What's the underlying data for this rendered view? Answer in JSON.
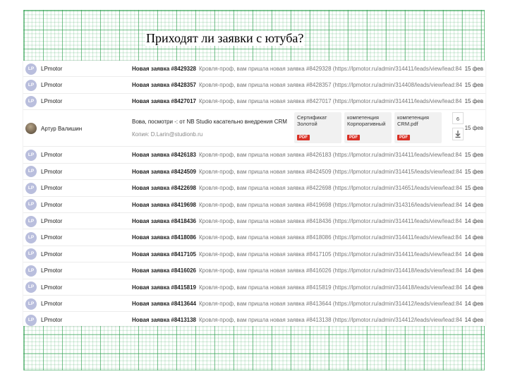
{
  "slide": {
    "title": "Приходят ли заявки с ютуба?"
  },
  "colors": {
    "avatar_bg": "#b9bedd",
    "pdf_badge": "#d93025",
    "grid_line": "#2ea050"
  },
  "inbox": {
    "rows_before": [
      {
        "avatar": "LP",
        "sender": "LPmotor",
        "subject": "Новая заявка #8429328",
        "preview": "Кровля-проф, вам пришла новая заявка #8429328 (https://lpmotor.ru/admin/314411/leads/view/lead:84...",
        "date": "15 фев"
      },
      {
        "avatar": "LP",
        "sender": "LPmotor",
        "subject": "Новая заявка #8428357",
        "preview": "Кровля-проф, вам пришла новая заявка #8428357 (https://lpmotor.ru/admin/314408/leads/view/lead:84...",
        "date": "15 фев"
      },
      {
        "avatar": "LP",
        "sender": "LPmotor",
        "subject": "Новая заявка #8427017",
        "preview": "Кровля-проф, вам пришла новая заявка #8427017 (https://lpmotor.ru/admin/314411/leads/view/lead:84...",
        "date": "15 фев"
      }
    ],
    "open_row": {
      "sender": "Артур Валишин",
      "subject": "Вова, посмотри -: от NB Studio касательно внедрения CRM",
      "copy": "Копия: D.Larin@studionb.ru",
      "attachments": [
        {
          "name": "Сертификат\nЗолотой",
          "badge": "PDF"
        },
        {
          "name": "компетенция\nКорпоративный",
          "badge": "PDF"
        },
        {
          "name": "компетенция\nCRM.pdf",
          "badge": "PDF"
        }
      ],
      "count": "6",
      "download_icon": "download-icon",
      "date": "15 фев"
    },
    "rows_after": [
      {
        "avatar": "LP",
        "sender": "LPmotor",
        "subject": "Новая заявка #8426183",
        "preview": "Кровля-проф, вам пришла новая заявка #8426183 (https://lpmotor.ru/admin/314411/leads/view/lead:84...",
        "date": "15 фев"
      },
      {
        "avatar": "LP",
        "sender": "LPmotor",
        "subject": "Новая заявка #8424509",
        "preview": "Кровля-проф, вам пришла новая заявка #8424509 (https://lpmotor.ru/admin/314415/leads/view/lead:84...",
        "date": "15 фев"
      },
      {
        "avatar": "LP",
        "sender": "LPmotor",
        "subject": "Новая заявка #8422698",
        "preview": "Кровля-проф, вам пришла новая заявка #8422698 (https://lpmotor.ru/admin/314651/leads/view/lead:84...",
        "date": "15 фев"
      },
      {
        "avatar": "LP",
        "sender": "LPmotor",
        "subject": "Новая заявка #8419698",
        "preview": "Кровля-проф, вам пришла новая заявка #8419698 (https://lpmotor.ru/admin/314316/leads/view/lead:84...",
        "date": "14 фев"
      },
      {
        "avatar": "LP",
        "sender": "LPmotor",
        "subject": "Новая заявка #8418436",
        "preview": "Кровля-проф, вам пришла новая заявка #8418436 (https://lpmotor.ru/admin/314411/leads/view/lead:84...",
        "date": "14 фев"
      },
      {
        "avatar": "LP",
        "sender": "LPmotor",
        "subject": "Новая заявка #8418086",
        "preview": "Кровля-проф, вам пришла новая заявка #8418086 (https://lpmotor.ru/admin/314411/leads/view/lead:84...",
        "date": "14 фев"
      },
      {
        "avatar": "LP",
        "sender": "LPmotor",
        "subject": "Новая заявка #8417105",
        "preview": "Кровля-проф, вам пришла новая заявка #8417105 (https://lpmotor.ru/admin/314411/leads/view/lead:84...",
        "date": "14 фев"
      },
      {
        "avatar": "LP",
        "sender": "LPmotor",
        "subject": "Новая заявка #8416026",
        "preview": "Кровля-проф, вам пришла новая заявка #8416026 (https://lpmotor.ru/admin/314418/leads/view/lead:84...",
        "date": "14 фев"
      },
      {
        "avatar": "LP",
        "sender": "LPmotor",
        "subject": "Новая заявка #8415819",
        "preview": "Кровля-проф, вам пришла новая заявка #8415819 (https://lpmotor.ru/admin/314418/leads/view/lead:84...",
        "date": "14 фев"
      },
      {
        "avatar": "LP",
        "sender": "LPmotor",
        "subject": "Новая заявка #8413644",
        "preview": "Кровля-проф, вам пришла новая заявка #8413644 (https://lpmotor.ru/admin/314412/leads/view/lead:84...",
        "date": "14 фев"
      },
      {
        "avatar": "LP",
        "sender": "LPmotor",
        "subject": "Новая заявка #8413138",
        "preview": "Кровля-проф, вам пришла новая заявка #8413138 (https://lpmotor.ru/admin/314412/leads/view/lead:84...",
        "date": "14 фев"
      }
    ]
  }
}
